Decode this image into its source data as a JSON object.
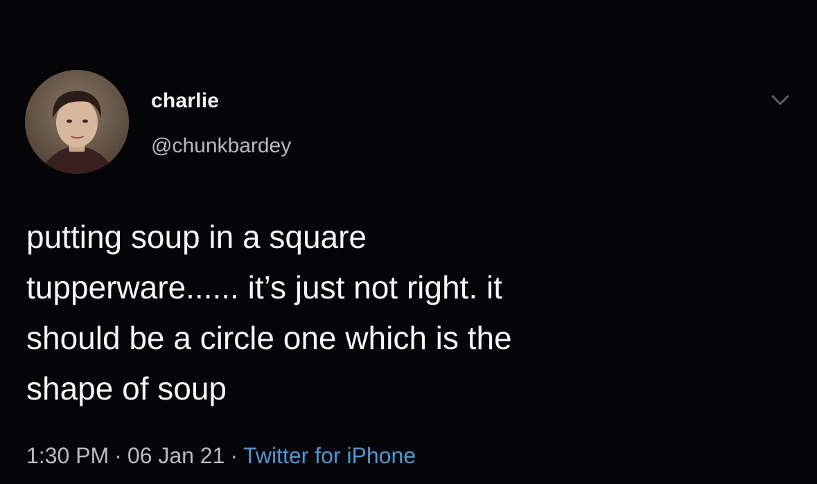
{
  "tweet": {
    "author": {
      "display_name": "charlie",
      "handle": "@chunkbardey"
    },
    "text": "putting soup in a square\ntupperware...... it’s just not right. it\nshould be a circle one which is the\nshape of soup",
    "time": "1:30 PM",
    "date": "06 Jan 21",
    "separator": "·",
    "source": "Twitter for iPhone"
  },
  "icons": {
    "avatar": "profile-photo",
    "menu": "chevron-down-icon"
  },
  "colors": {
    "background": "#050507",
    "text": "#f7f7f7",
    "secondary_text": "#bcbcbc",
    "link": "#4a99d4"
  }
}
